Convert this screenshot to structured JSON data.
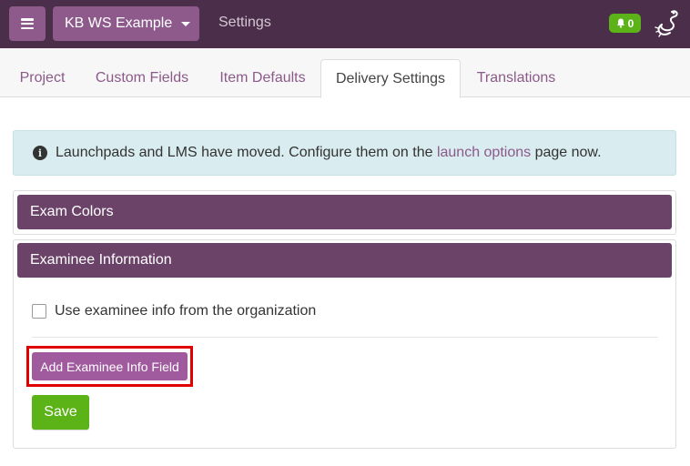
{
  "navbar": {
    "menu_icon": "hamburger-menu-icon",
    "project_name": "KB WS Example",
    "settings_label": "Settings",
    "notification_count": "0",
    "notification_icon": "bell-icon",
    "logo_icon": "scorpion-logo-icon",
    "colors": {
      "bar": "#4b2e4a",
      "button": "#8e5a8c",
      "badge": "#5cb318"
    }
  },
  "tabs": [
    {
      "label": "Project",
      "active": false
    },
    {
      "label": "Custom Fields",
      "active": false
    },
    {
      "label": "Item Defaults",
      "active": false
    },
    {
      "label": "Delivery Settings",
      "active": true
    },
    {
      "label": "Translations",
      "active": false
    }
  ],
  "alert": {
    "icon": "info-circle-icon",
    "text_before": "Launchpads and LMS have moved. Configure them on the ",
    "link_text": "launch options",
    "text_after": " page now."
  },
  "panels": {
    "exam_colors": {
      "title": "Exam Colors"
    },
    "examinee_info": {
      "title": "Examinee Information",
      "checkbox_label": "Use examinee info from the organization",
      "checkbox_checked": false,
      "add_button_label": "Add Examinee Info Field",
      "save_button_label": "Save"
    }
  },
  "colors": {
    "panel_header": "#6b4369",
    "accent_purple": "#a05a9e",
    "save_green": "#5cb318",
    "highlight_red": "#e00000",
    "alert_bg": "#d9ecef"
  }
}
